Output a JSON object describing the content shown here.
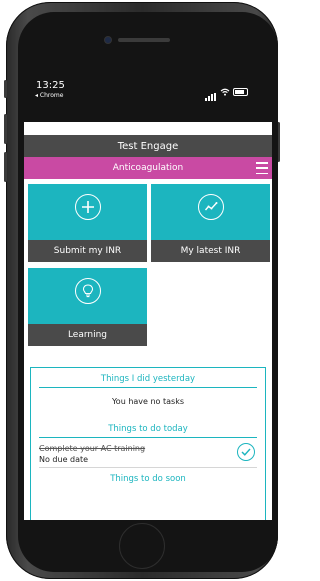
{
  "status_bar": {
    "time": "13:25",
    "back_app": "◂ Chrome"
  },
  "header": {
    "app_title": "Test Engage",
    "section_title": "Anticoagulation"
  },
  "tiles": [
    {
      "label": "Submit my INR",
      "icon": "plus-circle-icon"
    },
    {
      "label": "My latest INR",
      "icon": "trend-chart-icon"
    },
    {
      "label": "Learning",
      "icon": "lightbulb-icon"
    }
  ],
  "tasks": {
    "yesterday_heading": "Things I did yesterday",
    "yesterday_empty": "You have no tasks",
    "today_heading": "Things to do today",
    "today_items": [
      {
        "title": "Complete your AC training",
        "due": "No due date",
        "done": true
      }
    ],
    "soon_heading": "Things to do soon"
  },
  "colors": {
    "accent": "#1cb5bf",
    "header_bg": "#4a4a4a",
    "subheader_bg": "#c94aa3"
  }
}
